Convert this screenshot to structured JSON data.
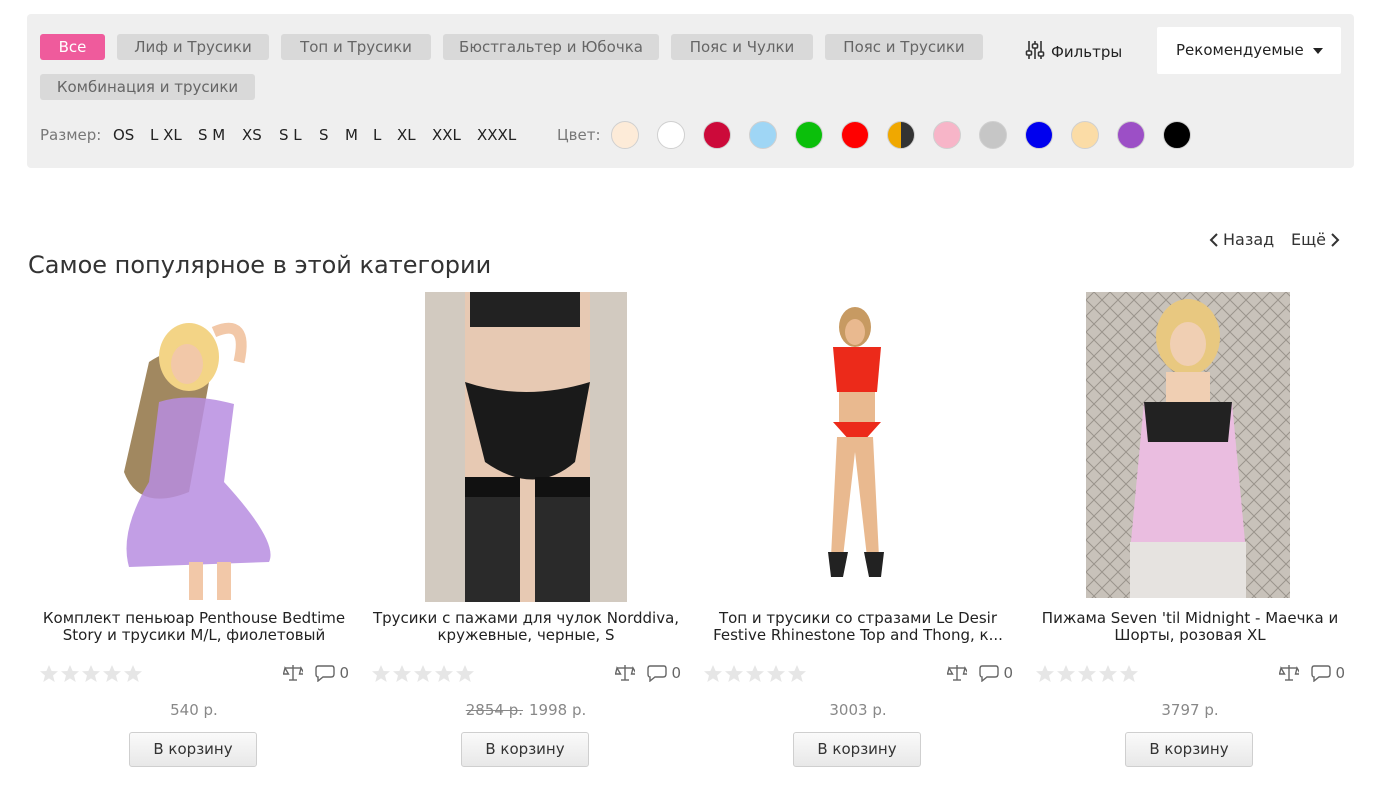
{
  "categories": [
    "Все",
    "Лиф и Трусики",
    "Топ и Трусики",
    "Бюстгальтер и Юбочка",
    "Пояс и Чулки",
    "Пояс и Трусики",
    "Комбинация и трусики"
  ],
  "filters_label": "Фильтры",
  "sort": {
    "selected": "Рекомендуемые"
  },
  "size_label": "Размер:",
  "sizes": [
    "OS",
    "L XL",
    "S M",
    "XS",
    "S L",
    "S",
    "M",
    "L",
    "XL",
    "XXL",
    "XXXL"
  ],
  "color_label": "Цвет:",
  "colors": [
    "#fdebd8",
    "#ffffff",
    "#cc0a3a",
    "#9fd6f5",
    "#0bbf0b",
    "#ff0000",
    "split:#f0a800|#333333",
    "#f7b5c8",
    "#c6c6c6",
    "#0000ee",
    "#fbdca6",
    "#9c4fc6",
    "#000000"
  ],
  "pager": {
    "back": "Назад",
    "more": "Ещё"
  },
  "section_title": "Самое популярное в этой категории",
  "products": [
    {
      "title_line1": "Комплект пеньюар Penthouse Bedtime",
      "title_line2": "Story и трусики M/L, фиолетовый",
      "old_price": "",
      "price": "540 р.",
      "comments": "0",
      "cart": "В корзину"
    },
    {
      "title_line1": "Трусики с пажами для чулок Norddiva,",
      "title_line2": "кружевные, черные, S",
      "old_price": "2854 р.",
      "price": "1998 р.",
      "comments": "0",
      "cart": "В корзину"
    },
    {
      "title_line1": "Топ и трусики со стразами Le Desir",
      "title_line2": "Festive Rhinestone Top and Thong, к...",
      "old_price": "",
      "price": "3003 р.",
      "comments": "0",
      "cart": "В корзину"
    },
    {
      "title_line1": "Пижама Seven 'til Midnight - Маечка и",
      "title_line2": "Шорты, розовая XL",
      "old_price": "",
      "price": "3797 р.",
      "comments": "0",
      "cart": "В корзину"
    }
  ]
}
